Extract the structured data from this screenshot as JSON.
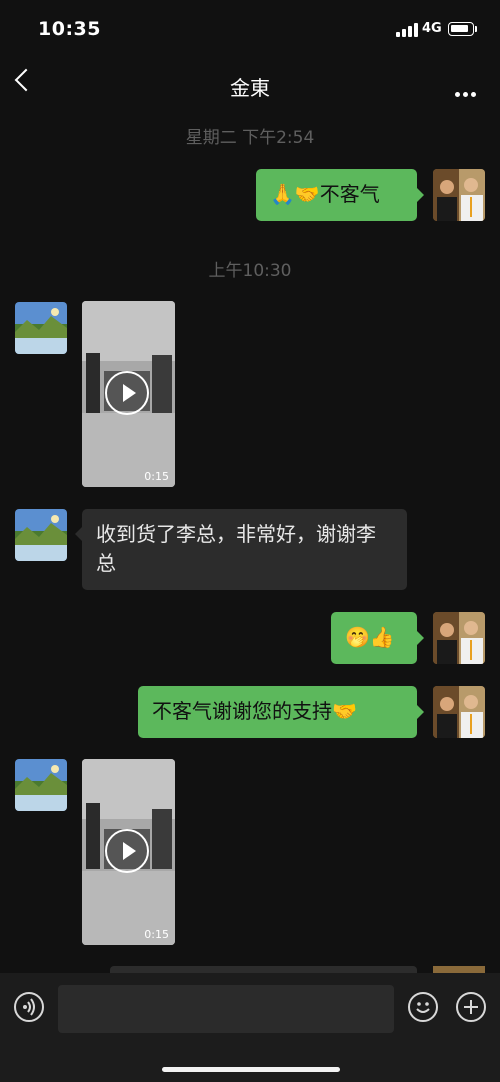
{
  "status_bar": {
    "time": "10:35",
    "network": "4G"
  },
  "header": {
    "title": "金東"
  },
  "messages": [
    {
      "type": "timestamp",
      "text": "星期二 下午2:54"
    },
    {
      "type": "out",
      "text": "🙏🤝不客气"
    },
    {
      "type": "timestamp",
      "text": "上午10:30"
    },
    {
      "type": "in-video",
      "duration": "0:15"
    },
    {
      "type": "in",
      "text": "收到货了李总，非常好，谢谢李总"
    },
    {
      "type": "out",
      "text": "🤭👍"
    },
    {
      "type": "out",
      "text": "不客气谢谢您的支持🤝"
    },
    {
      "type": "in-video",
      "duration": "0:15"
    }
  ],
  "icons": {
    "voice": "voice-icon",
    "emoji": "emoji-icon",
    "add": "add-icon"
  },
  "colors": {
    "out_bubble": "#5cb85c",
    "in_bubble": "#2c2c2c",
    "background": "#111111"
  }
}
